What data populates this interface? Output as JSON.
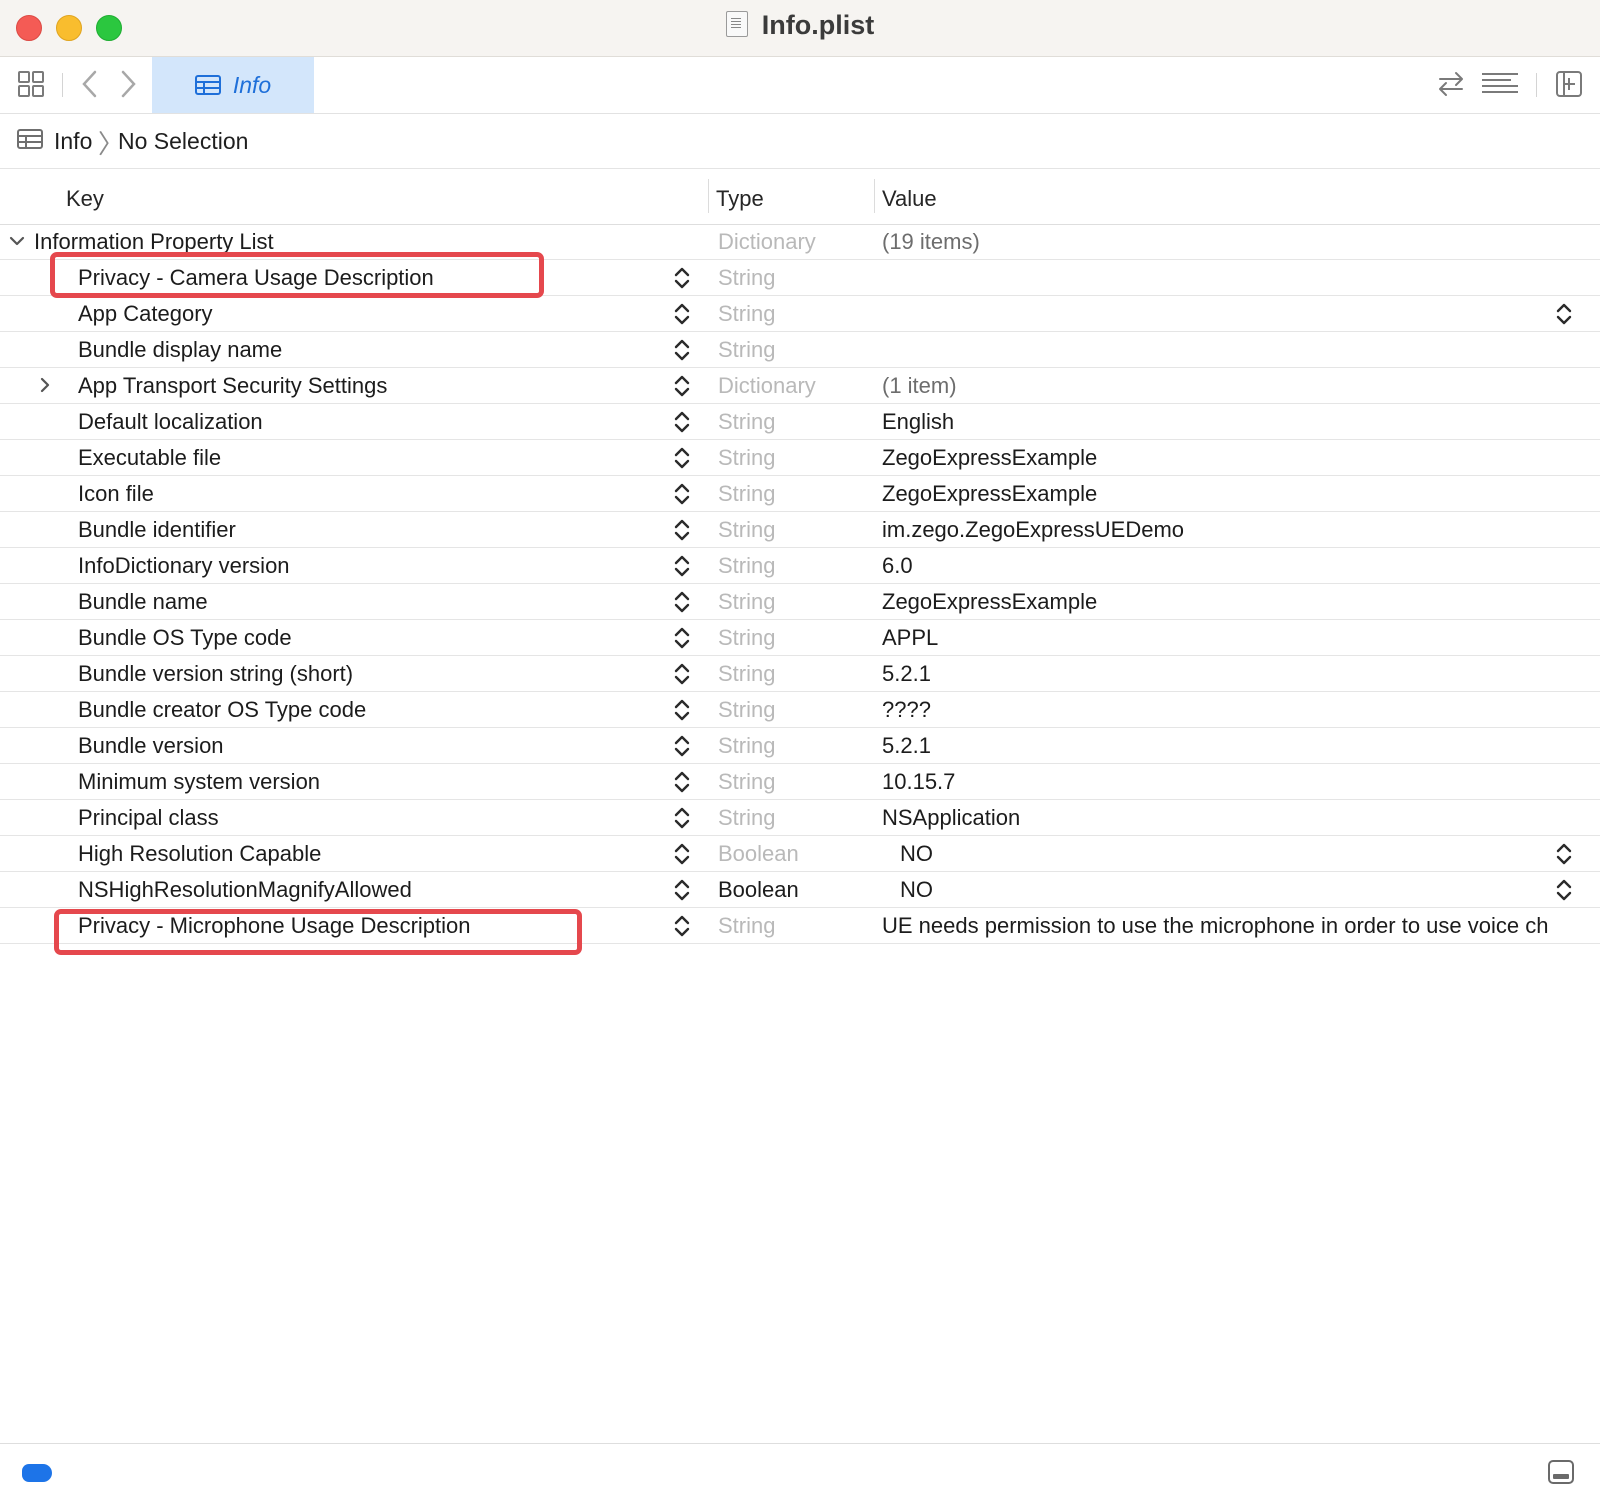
{
  "window": {
    "title": "Info.plist"
  },
  "toolbar": {
    "tab_label": "Info"
  },
  "jumpbar": {
    "item": "Info",
    "selection": "No Selection"
  },
  "columns": {
    "key": "Key",
    "type": "Type",
    "value": "Value"
  },
  "rows": [
    {
      "key": "Information Property List",
      "type": "Dictionary",
      "value": "(19 items)",
      "level": 0,
      "disclosure": "expanded"
    },
    {
      "key": "Privacy - Camera Usage Description",
      "type": "String",
      "value": "",
      "level": 1
    },
    {
      "key": "App Category",
      "type": "String",
      "value": "",
      "level": 1,
      "value_stepper": true
    },
    {
      "key": "Bundle display name",
      "type": "String",
      "value": "",
      "level": 1
    },
    {
      "key": "App Transport Security Settings",
      "type": "Dictionary",
      "value": "(1 item)",
      "level": 1,
      "disclosure": "collapsed"
    },
    {
      "key": "Default localization",
      "type": "String",
      "value": "English",
      "level": 1
    },
    {
      "key": "Executable file",
      "type": "String",
      "value": "ZegoExpressExample",
      "level": 1
    },
    {
      "key": "Icon file",
      "type": "String",
      "value": "ZegoExpressExample",
      "level": 1
    },
    {
      "key": "Bundle identifier",
      "type": "String",
      "value": "im.zego.ZegoExpressUEDemo",
      "level": 1
    },
    {
      "key": "InfoDictionary version",
      "type": "String",
      "value": "6.0",
      "level": 1
    },
    {
      "key": "Bundle name",
      "type": "String",
      "value": "ZegoExpressExample",
      "level": 1
    },
    {
      "key": "Bundle OS Type code",
      "type": "String",
      "value": "APPL",
      "level": 1
    },
    {
      "key": "Bundle version string (short)",
      "type": "String",
      "value": "5.2.1",
      "level": 1
    },
    {
      "key": "Bundle creator OS Type code",
      "type": "String",
      "value": "????",
      "level": 1
    },
    {
      "key": "Bundle version",
      "type": "String",
      "value": "5.2.1",
      "level": 1
    },
    {
      "key": "Minimum system version",
      "type": "String",
      "value": "10.15.7",
      "level": 1
    },
    {
      "key": "Principal class",
      "type": "String",
      "value": "NSApplication",
      "level": 1
    },
    {
      "key": "High Resolution Capable",
      "type": "Boolean",
      "value": "NO",
      "level": 1,
      "value_stepper": true
    },
    {
      "key": "NSHighResolutionMagnifyAllowed",
      "type": "Boolean",
      "value": "NO",
      "level": 1,
      "value_stepper": true,
      "type_active": true
    },
    {
      "key": "Privacy - Microphone Usage Description",
      "type": "String",
      "value": "UE needs permission to use the microphone in order to use voice ch",
      "level": 1
    }
  ],
  "colors": {
    "accent": "#1e6fd9",
    "highlight_box": "#e5484d",
    "tab_background": "#d3e6fb"
  }
}
